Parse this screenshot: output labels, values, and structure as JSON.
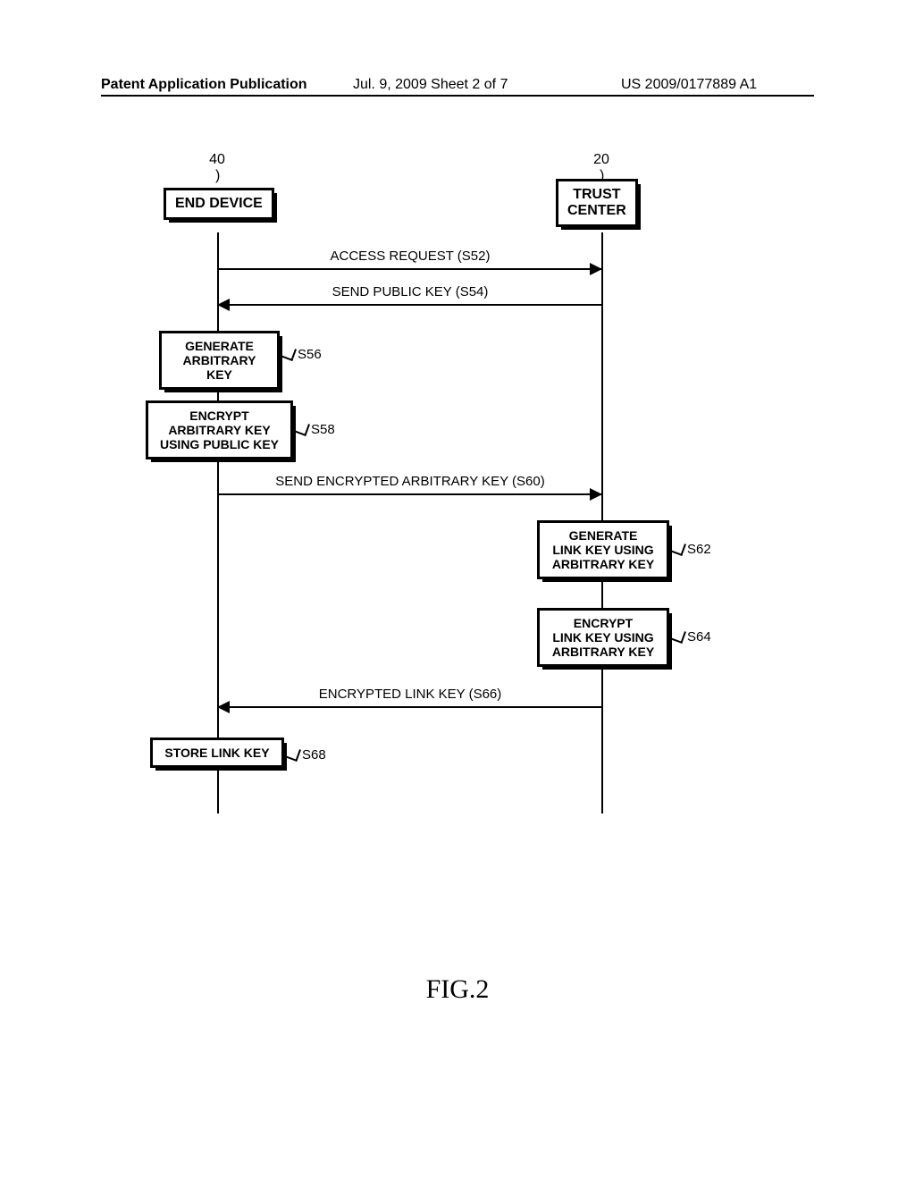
{
  "header": {
    "left": "Patent Application Publication",
    "center": "Jul. 9, 2009  Sheet 2 of 7",
    "right": "US 2009/0177889 A1"
  },
  "participants": {
    "left": {
      "ref": "40",
      "label": "END DEVICE"
    },
    "right": {
      "ref": "20",
      "label": "TRUST\nCENTER"
    }
  },
  "messages": {
    "m1": "ACCESS REQUEST (S52)",
    "m2": "SEND PUBLIC KEY (S54)",
    "m3": "SEND ENCRYPTED ARBITRARY KEY (S60)",
    "m4": "ENCRYPTED LINK KEY (S66)"
  },
  "processes": {
    "p56": {
      "label": "GENERATE\nARBITRARY KEY",
      "ref": "S56"
    },
    "p58": {
      "label": "ENCRYPT\nARBITRARY KEY\nUSING PUBLIC KEY",
      "ref": "S58"
    },
    "p62": {
      "label": "GENERATE\nLINK KEY USING\nARBITRARY KEY",
      "ref": "S62"
    },
    "p64": {
      "label": "ENCRYPT\nLINK KEY USING\nARBITRARY KEY",
      "ref": "S64"
    },
    "p68": {
      "label": "STORE LINK KEY",
      "ref": "S68"
    }
  },
  "figure_label": "FIG.2"
}
